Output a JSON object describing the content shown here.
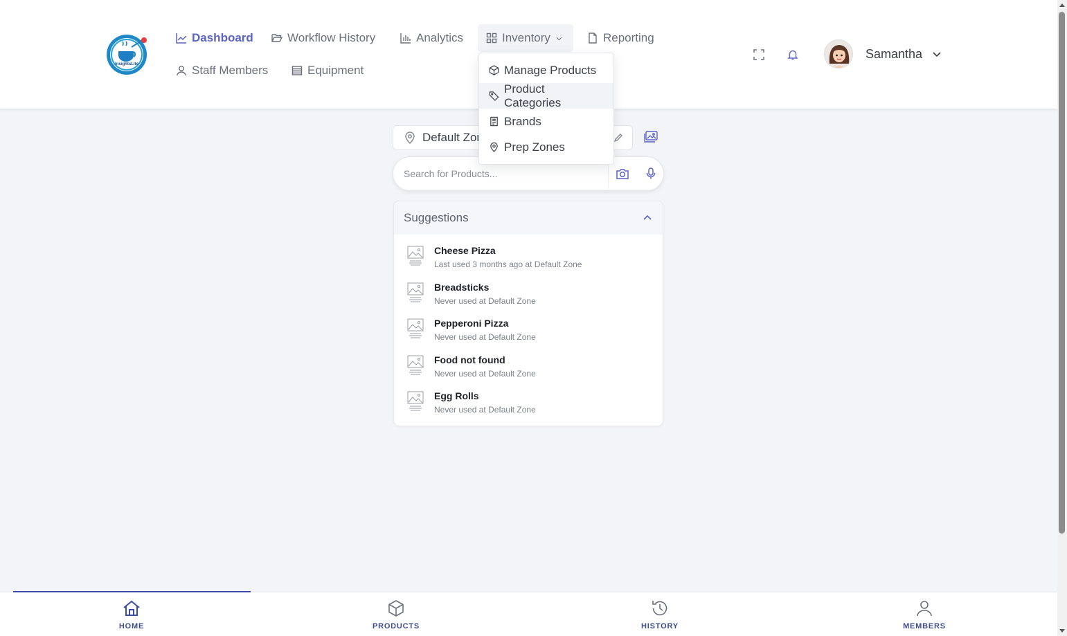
{
  "header": {
    "logo_text": "InsightsLite",
    "nav": [
      {
        "label": "Dashboard",
        "icon": "trend-chart-icon",
        "active": true
      },
      {
        "label": "Workflow History",
        "icon": "folder-open-icon"
      },
      {
        "label": "Analytics",
        "icon": "bar-chart-icon"
      },
      {
        "label": "Inventory",
        "icon": "grid-icon",
        "open": true
      },
      {
        "label": "Reporting",
        "icon": "file-icon"
      },
      {
        "label": "Staff Members",
        "icon": "user-icon"
      },
      {
        "label": "Equipment",
        "icon": "list-icon"
      }
    ],
    "user": {
      "name": "Samantha"
    }
  },
  "inventory_menu": [
    {
      "label": "Manage Products",
      "icon": "box-icon"
    },
    {
      "label": "Product Categories",
      "icon": "tag-icon",
      "hover": true
    },
    {
      "label": "Brands",
      "icon": "document-icon"
    },
    {
      "label": "Prep Zones",
      "icon": "map-pin-icon"
    }
  ],
  "zone": {
    "value": "Default Zone"
  },
  "search": {
    "placeholder": "Search for Products..."
  },
  "suggestions": {
    "title": "Suggestions",
    "items": [
      {
        "name": "Cheese Pizza",
        "sub": "Last used 3 months ago at Default Zone"
      },
      {
        "name": "Breadsticks",
        "sub": "Never used at Default Zone"
      },
      {
        "name": "Pepperoni Pizza",
        "sub": "Never used at Default Zone"
      },
      {
        "name": "Food not found",
        "sub": "Never used at Default Zone"
      },
      {
        "name": "Egg Rolls",
        "sub": "Never used at Default Zone"
      }
    ]
  },
  "bottom_nav": [
    {
      "label": "HOME",
      "icon": "home-icon",
      "active": true
    },
    {
      "label": "PRODUCTS",
      "icon": "box-icon"
    },
    {
      "label": "HISTORY",
      "icon": "history-icon"
    },
    {
      "label": "MEMBERS",
      "icon": "user-icon"
    }
  ],
  "colors": {
    "accent": "#5b63c4",
    "nav_text": "#6b6f7b",
    "bottom_accent": "#3a4ba8",
    "background": "#f3f4f7"
  }
}
